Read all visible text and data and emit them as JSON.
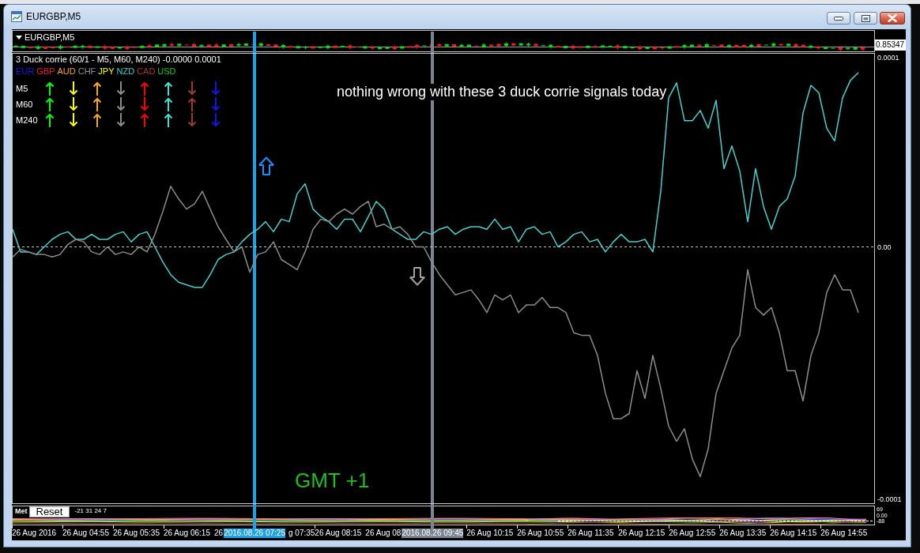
{
  "window": {
    "title": "EURGBP,M5"
  },
  "price_pane": {
    "symbol": "EURGBP,M5",
    "price": "0.85347"
  },
  "indicator": {
    "title": "3 Duck corrie (60/1 - M5, M60, M240) -0.0000 0.0001",
    "currencies": [
      {
        "code": "EUR",
        "color": "#1c1cd0"
      },
      {
        "code": "GBP",
        "color": "#e02424"
      },
      {
        "code": "AUD",
        "color": "#f0a030"
      },
      {
        "code": "CHF",
        "color": "#909090"
      },
      {
        "code": "JPY",
        "color": "#ffff00"
      },
      {
        "code": "NZD",
        "color": "#3ccfcf"
      },
      {
        "code": "CAD",
        "color": "#a23c32"
      },
      {
        "code": "USD",
        "color": "#22c022"
      }
    ],
    "signals": [
      {
        "timeframe": "M5",
        "arrows": [
          {
            "kind": "up",
            "color": "#00ff00"
          },
          {
            "kind": "down",
            "color": "#ffff00"
          },
          {
            "kind": "up",
            "color": "#f4a430"
          },
          {
            "kind": "down",
            "color": "#8a8a8a"
          },
          {
            "kind": "up",
            "color": "#ff0000"
          },
          {
            "kind": "up",
            "color": "#40e0d0"
          },
          {
            "kind": "down",
            "color": "#9b3a30"
          },
          {
            "kind": "down",
            "color": "#1414e6"
          }
        ]
      },
      {
        "timeframe": "M60",
        "arrows": [
          {
            "kind": "up",
            "color": "#00ff00"
          },
          {
            "kind": "down",
            "color": "#ffff00"
          },
          {
            "kind": "up",
            "color": "#f4a430"
          },
          {
            "kind": "down",
            "color": "#8a8a8a"
          },
          {
            "kind": "down",
            "color": "#ff0000"
          },
          {
            "kind": "up",
            "color": "#40e0d0"
          },
          {
            "kind": "up",
            "color": "#9b3a30"
          },
          {
            "kind": "down",
            "color": "#1414e6"
          }
        ]
      },
      {
        "timeframe": "M240",
        "arrows": [
          {
            "kind": "up",
            "color": "#00ff00"
          },
          {
            "kind": "down",
            "color": "#ffff00"
          },
          {
            "kind": "up",
            "color": "#f4a430"
          },
          {
            "kind": "down",
            "color": "#8a8a8a"
          },
          {
            "kind": "up",
            "color": "#ff0000"
          },
          {
            "kind": "up",
            "color": "#40e0d0"
          },
          {
            "kind": "down",
            "color": "#9b3a30"
          },
          {
            "kind": "down",
            "color": "#1414e6"
          }
        ]
      }
    ],
    "note": "nothing wrong with these 3 duck corrie signals today",
    "timezone_label": "GMT +1",
    "markers": [
      {
        "kind": "up",
        "color": "#1e90ff"
      },
      {
        "kind": "down",
        "color": "#a0a0a0"
      }
    ],
    "chart_data": {
      "type": "line",
      "ylim": [
        -0.0001015,
        7.65e-05
      ],
      "yticks": [
        {
          "value": 7.5e-05,
          "label": "0.0001"
        },
        {
          "value": 0,
          "label": "0.00"
        },
        {
          "value": -0.0001,
          "label": "-0.0001"
        }
      ],
      "series": [
        {
          "color": "#48d1cc",
          "values": [
            7e-06,
            -2e-06,
            -2e-06,
            -3e-06,
            0,
            3e-06,
            5e-06,
            6e-06,
            3e-06,
            3e-06,
            5e-06,
            3e-06,
            3e-06,
            5e-06,
            6e-06,
            2e-06,
            5e-06,
            6e-06,
            0,
            -6e-06,
            -1.1e-05,
            -1.4e-05,
            -1.5e-05,
            -1.6e-05,
            -1.6e-05,
            -1.1e-05,
            -5e-06,
            -3e-06,
            -2e-06,
            2e-06,
            5e-06,
            7e-06,
            1e-05,
            6e-06,
            1.1e-05,
            1e-05,
            2.1e-05,
            2.5e-05,
            1.5e-05,
            1.2e-05,
            1e-05,
            7e-06,
            1.1e-05,
            1.1e-05,
            6e-06,
            1.2e-05,
            1.8e-05,
            1.5e-05,
            7e-06,
            5e-06,
            3e-06,
            3e-06,
            6e-06,
            5e-06,
            7e-06,
            8e-06,
            5e-06,
            7e-06,
            8e-06,
            8e-06,
            7e-06,
            1.1e-05,
            7e-06,
            8e-06,
            2e-06,
            7e-06,
            8e-06,
            5e-06,
            6e-06,
            0,
            2e-06,
            5e-06,
            6e-06,
            2e-06,
            3e-06,
            -2e-06,
            2e-06,
            5e-06,
            2e-06,
            2e-06,
            3e-06,
            -2e-06,
            2.2e-05,
            5.9e-05,
            6.5e-05,
            5e-05,
            5e-05,
            5.4e-05,
            4.7e-05,
            5.8e-05,
            3.1e-05,
            4e-05,
            3e-05,
            1e-05,
            3.1e-05,
            1.6e-05,
            7e-06,
            1.6e-05,
            1.9e-05,
            2.8e-05,
            5.3e-05,
            6.4e-05,
            6.1e-05,
            4.7e-05,
            4.2e-05,
            5.9e-05,
            6.6e-05,
            6.9e-05
          ]
        },
        {
          "color": "#8c8c8c",
          "values": [
            -4e-06,
            -1e-06,
            -2e-06,
            -3e-06,
            -3e-06,
            -4e-06,
            -3e-06,
            1e-06,
            3e-06,
            2e-06,
            -2e-06,
            -3e-06,
            0,
            -3e-06,
            -2e-06,
            -3e-06,
            0,
            -2e-06,
            5e-06,
            1.4e-05,
            2.4e-05,
            1.9e-05,
            1.5e-05,
            1.7e-05,
            2.2e-05,
            1.5e-05,
            8e-06,
            3e-06,
            -2e-06,
            0,
            -1e-05,
            -3e-06,
            -2e-06,
            2e-06,
            -5e-06,
            -7e-06,
            -9e-06,
            -2e-06,
            7e-06,
            1.1e-05,
            1e-05,
            1.3e-05,
            1.5e-05,
            1.3e-05,
            1.6e-05,
            1.8e-05,
            8e-06,
            9e-06,
            7e-06,
            8e-06,
            5e-06,
            0,
            0,
            -6e-06,
            -1.1e-05,
            -1.5e-05,
            -1.9e-05,
            -1.8e-05,
            -1.7e-05,
            -2.1e-05,
            -2.6e-05,
            -1.9e-05,
            -2.1e-05,
            -1.9e-05,
            -2.6e-05,
            -2.3e-05,
            -2.3e-05,
            -2e-05,
            -2.4e-05,
            -2.4e-05,
            -2.6e-05,
            -3.4e-05,
            -3.5e-05,
            -3.5e-05,
            -4.3e-05,
            -5.8e-05,
            -6.8e-05,
            -6.8e-05,
            -6.6e-05,
            -4.9e-05,
            -6e-05,
            -4.3e-05,
            -5.6e-05,
            -7.1e-05,
            -7.7e-05,
            -7.2e-05,
            -8.4e-05,
            -9.1e-05,
            -8e-05,
            -5.8e-05,
            -4.9e-05,
            -4e-05,
            -3.5e-05,
            -9e-06,
            -2.4e-05,
            -2.7e-05,
            -2.4e-05,
            -3.4e-05,
            -4.9e-05,
            -4.9e-05,
            -6.1e-05,
            -4.3e-05,
            -3.4e-05,
            -1.8e-05,
            -1.1e-05,
            -1.7e-05,
            -1.7e-05,
            -2.6e-05
          ]
        }
      ]
    }
  },
  "met_pane": {
    "label": "Met",
    "reset_button": "Reset",
    "readout": "-21 31 24 7",
    "scale": [
      "69",
      "0.00",
      "-88"
    ]
  },
  "time_axis": {
    "labels": [
      {
        "kind": "tick",
        "text": "26 Aug 2016"
      },
      {
        "kind": "tick",
        "text": "26 Aug 04:55"
      },
      {
        "kind": "tick",
        "text": "26 Aug 05:35"
      },
      {
        "kind": "tick",
        "text": "26 Aug 06:15"
      },
      {
        "kind": "cut",
        "text": "26"
      },
      {
        "kind": "cursor",
        "text": "2016.08.26 07:25",
        "color": "#1ba3e6"
      },
      {
        "kind": "cut",
        "text": "g 07:35"
      },
      {
        "kind": "tick",
        "text": "26 Aug 08:15"
      },
      {
        "kind": "cut",
        "text": "26 Aug 08"
      },
      {
        "kind": "cursor",
        "text": "2016.08.26 09:45",
        "color": "#7b8591"
      },
      {
        "kind": "tick",
        "text": "26 Aug 10:15"
      },
      {
        "kind": "tick",
        "text": "26 Aug 10:55"
      },
      {
        "kind": "tick",
        "text": "26 Aug 11:35"
      },
      {
        "kind": "tick",
        "text": "26 Aug 12:15"
      },
      {
        "kind": "tick",
        "text": "26 Aug 12:55"
      },
      {
        "kind": "tick",
        "text": "26 Aug 13:35"
      },
      {
        "kind": "tick",
        "text": "26 Aug 14:15"
      },
      {
        "kind": "tick",
        "text": "26 Aug 14:55"
      }
    ]
  }
}
